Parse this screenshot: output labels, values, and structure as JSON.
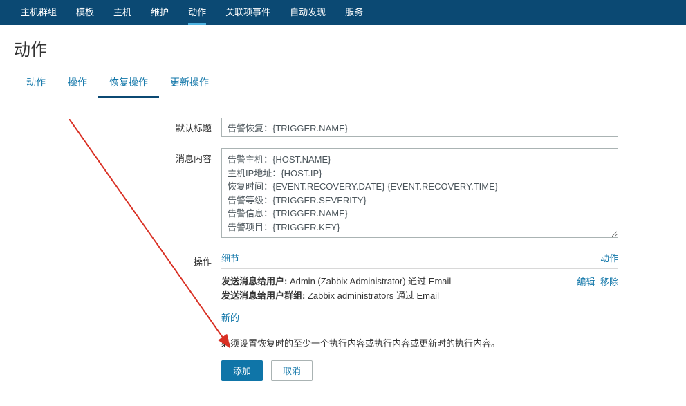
{
  "topnav": {
    "items": [
      "主机群组",
      "模板",
      "主机",
      "维护",
      "动作",
      "关联项事件",
      "自动发现",
      "服务"
    ],
    "activeIndex": 4
  },
  "pageTitle": "动作",
  "subtabs": {
    "items": [
      "动作",
      "操作",
      "恢复操作",
      "更新操作"
    ],
    "activeIndex": 2
  },
  "form": {
    "defaultSubjectLabel": "默认标题",
    "defaultSubject": "告警恢复：{TRIGGER.NAME}",
    "messageLabel": "消息内容",
    "messageContent": "告警主机：{HOST.NAME}\n主机IP地址：{HOST.IP}\n恢复时间：{EVENT.RECOVERY.DATE} {EVENT.RECOVERY.TIME}\n告警等级：{TRIGGER.SEVERITY}\n告警信息：{TRIGGER.NAME}\n告警项目：{TRIGGER.KEY}",
    "operationsLabel": "操作",
    "opsHeaderDetail": "细节",
    "opsHeaderAction": "动作",
    "opsLine1Prefix": "发送消息给用户:",
    "opsLine1Content": " Admin (Zabbix Administrator) 通过 Email",
    "opsLine2Prefix": "发送消息给用户群组:",
    "opsLine2Content": " Zabbix administrators 通过 Email",
    "editLink": "编辑",
    "removeLink": "移除",
    "newLink": "新的",
    "footnote": "必须设置恢复时的至少一个执行内容或执行内容或更新时的执行内容。",
    "addBtn": "添加",
    "cancelBtn": "取消"
  }
}
